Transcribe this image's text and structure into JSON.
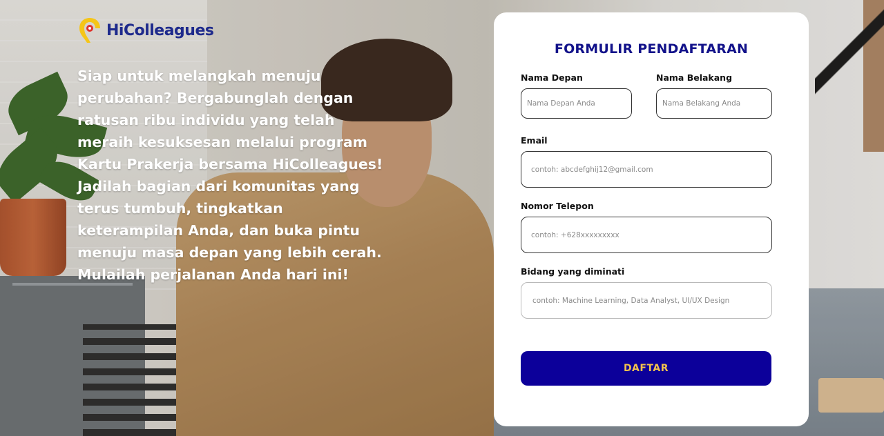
{
  "brand": {
    "name": "HiColleagues"
  },
  "hero": {
    "lines": [
      "Siap untuk melangkah menuju",
      "perubahan? Bergabunglah dengan",
      "ratusan ribu individu yang telah",
      "meraih kesuksesan melalui program",
      "Kartu Prakerja bersama HiColleagues!",
      "Jadilah bagian dari komunitas yang",
      "terus tumbuh, tingkatkan",
      "keterampilan Anda, dan buka pintu",
      "menuju masa depan yang lebih cerah.",
      "Mulailah perjalanan Anda hari ini!"
    ]
  },
  "form": {
    "title": "FORMULIR PENDAFTARAN",
    "first_name": {
      "label": "Nama Depan",
      "placeholder": "Nama Depan Anda",
      "value": ""
    },
    "last_name": {
      "label": "Nama Belakang",
      "placeholder": "Nama Belakang Anda",
      "value": ""
    },
    "email": {
      "label": "Email",
      "placeholder": "contoh: abcdefghij12@gmail.com",
      "value": ""
    },
    "phone": {
      "label": "Nomor Telepon",
      "placeholder": "contoh: +628xxxxxxxxx",
      "value": ""
    },
    "interest": {
      "label": "Bidang yang diminati",
      "placeholder": "contoh: Machine Learning, Data Analyst, UI/UX Design",
      "value": ""
    },
    "submit_label": "DAFTAR"
  },
  "colors": {
    "primary": "#0c009a",
    "title": "#12128a",
    "button_text": "#f2c14e",
    "brand_text": "#1e2a8c",
    "logo_yellow": "#f5c518",
    "logo_red": "#e0312b"
  }
}
